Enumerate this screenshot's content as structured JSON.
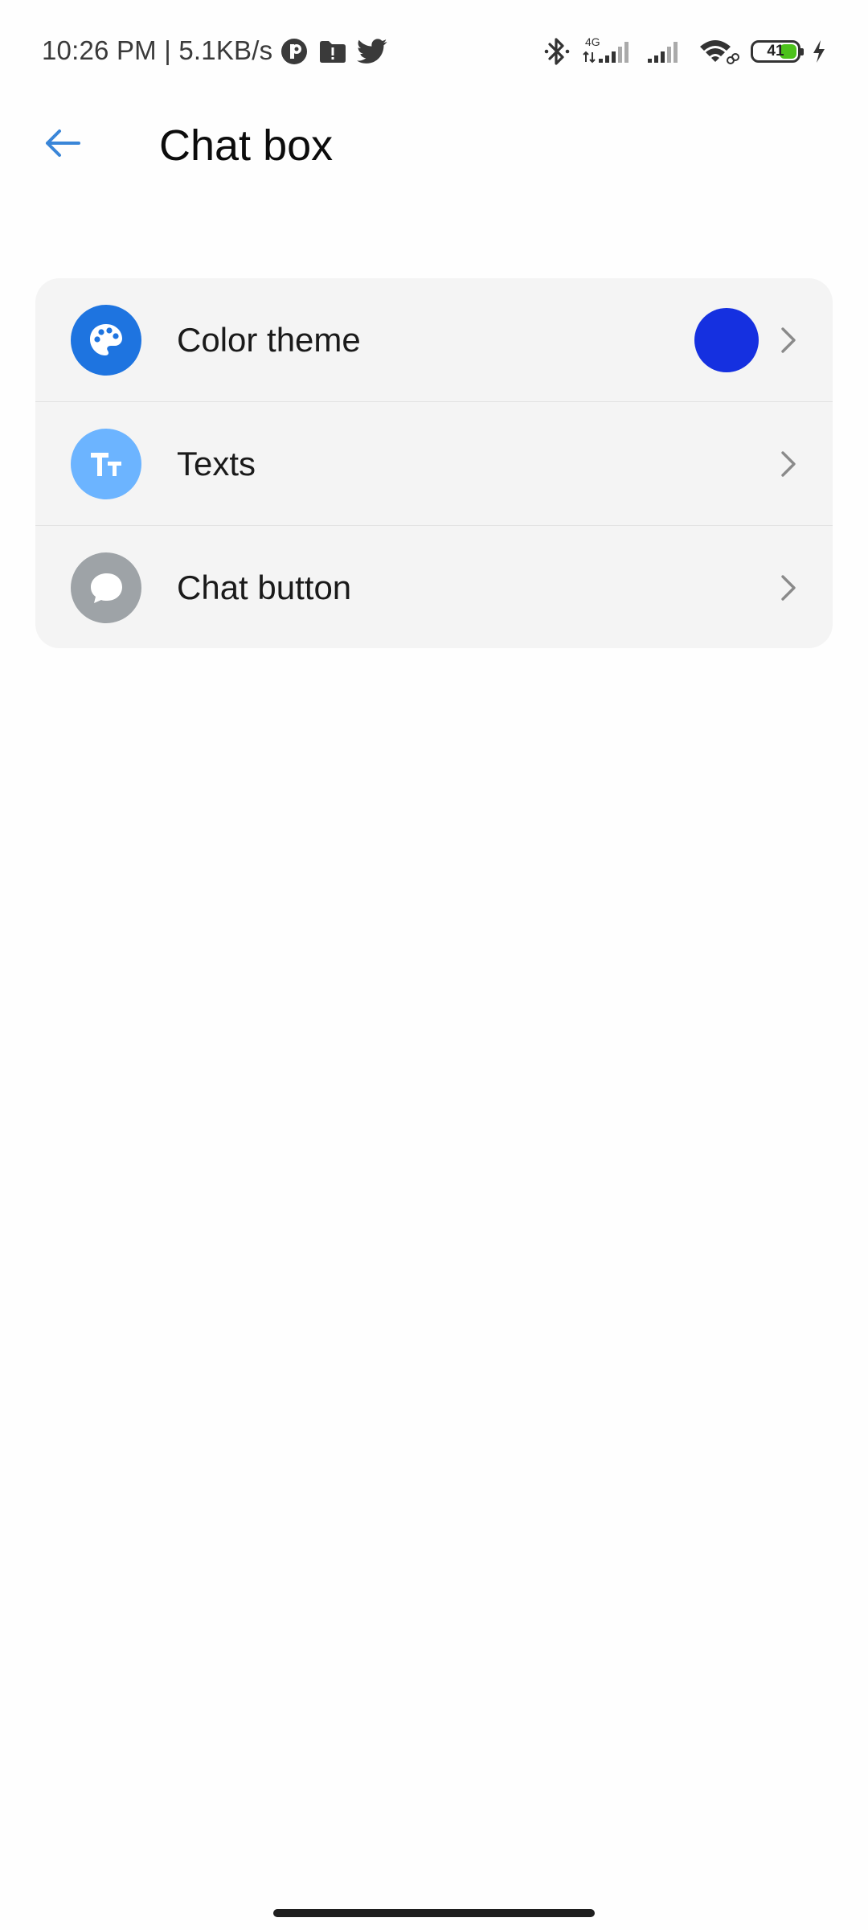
{
  "status_bar": {
    "time_text": "10:26 PM | 5.1KB/s",
    "network_type": "4G",
    "battery_level": "41",
    "battery_fraction": 0.41,
    "left_icons": [
      "notification-app-icon",
      "folder-alert-icon",
      "twitter-icon"
    ],
    "right_icons": [
      "bluetooth-icon",
      "signal-4g-icon",
      "signal-icon",
      "wifi-icon",
      "battery-icon",
      "charging-icon"
    ]
  },
  "header": {
    "back_icon": "arrow-left-icon",
    "title": "Chat box",
    "accent_color": "#3a86d8"
  },
  "settings": {
    "items": [
      {
        "label": "Color theme",
        "icon": "palette-icon",
        "icon_bg": "#1e74e0",
        "value_swatch_color": "#1530e0",
        "chevron": "chevron-right-icon"
      },
      {
        "label": "Texts",
        "icon": "text-size-icon",
        "icon_bg": "#6cb4ff",
        "chevron": "chevron-right-icon"
      },
      {
        "label": "Chat button",
        "icon": "chat-bubble-icon",
        "icon_bg": "#9ea3a7",
        "chevron": "chevron-right-icon"
      }
    ]
  }
}
